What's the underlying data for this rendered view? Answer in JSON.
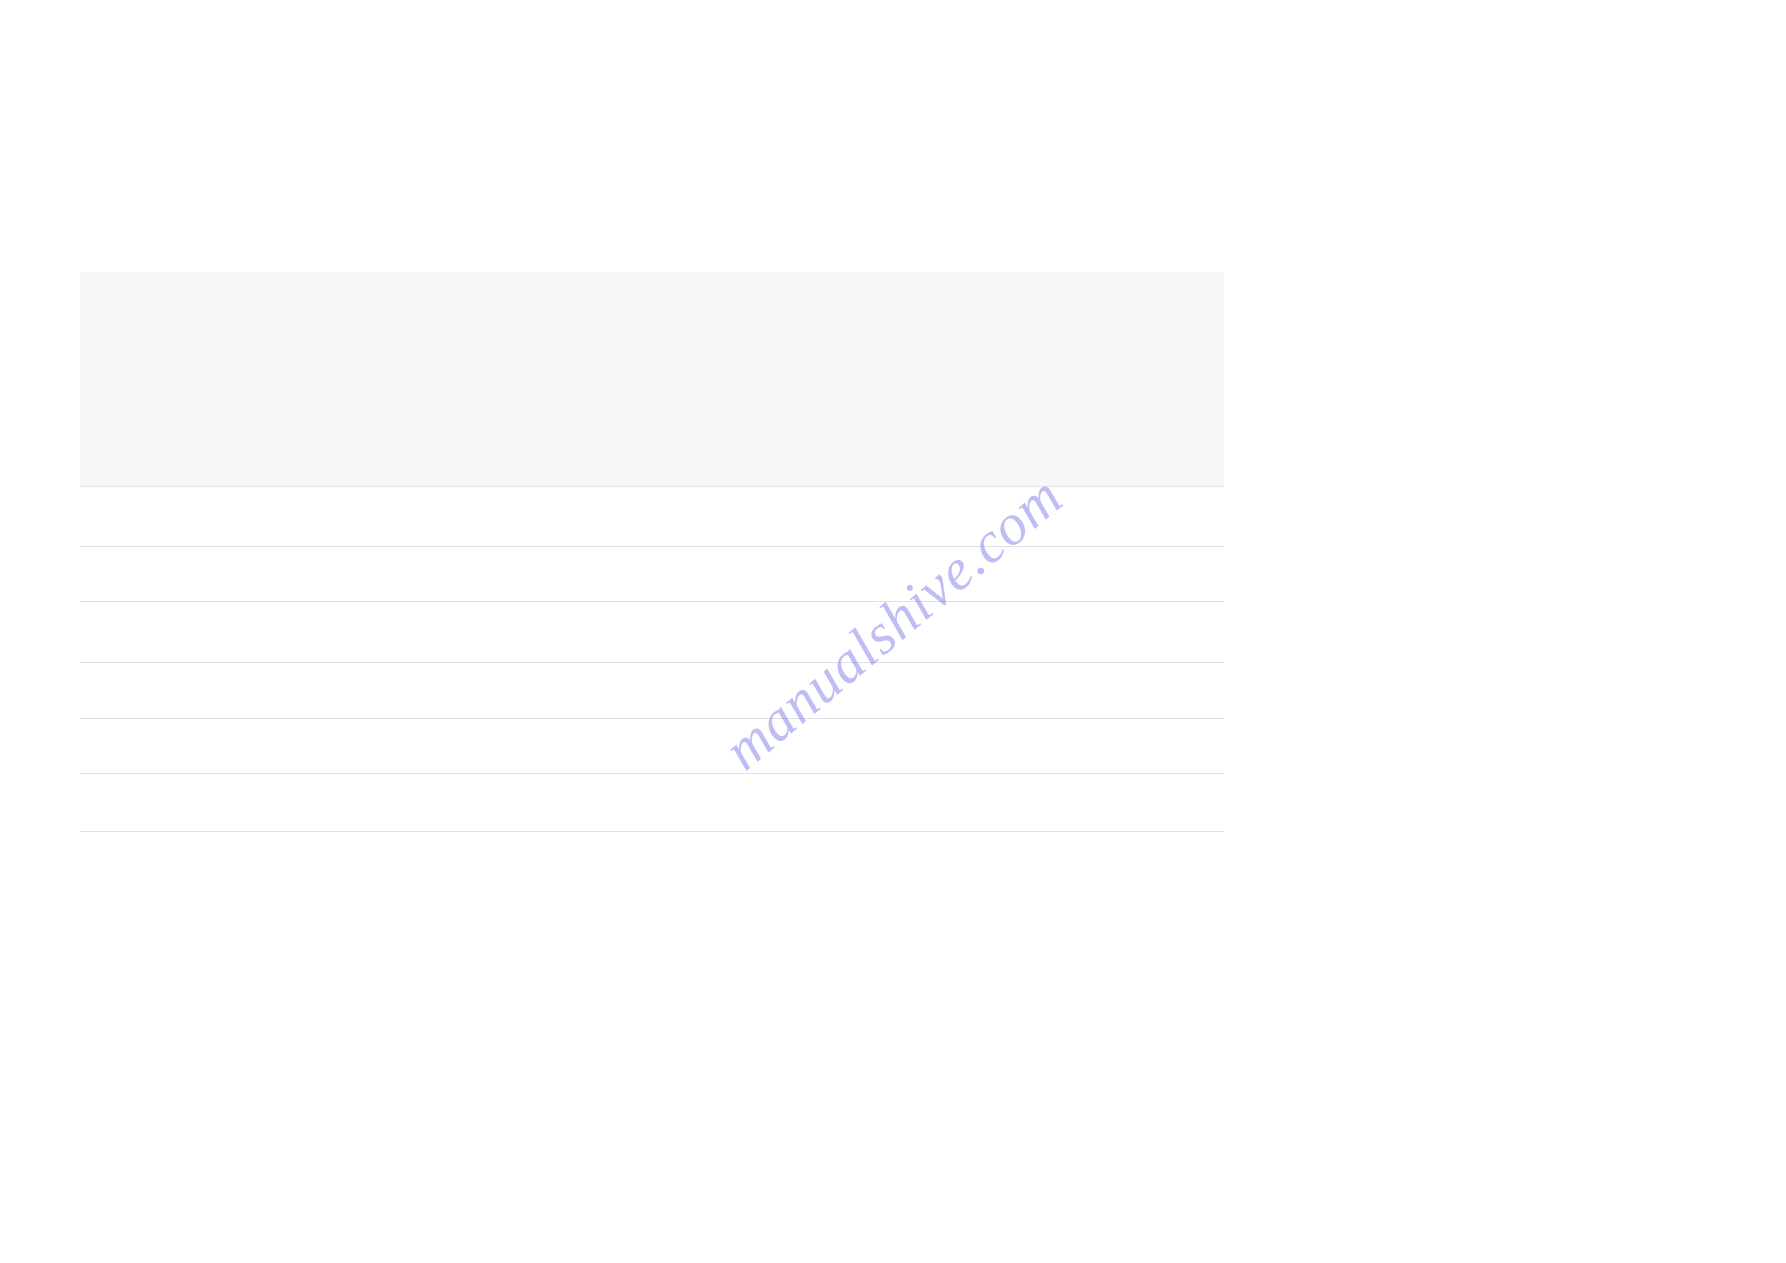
{
  "watermark": {
    "text": "manualshive.com"
  }
}
